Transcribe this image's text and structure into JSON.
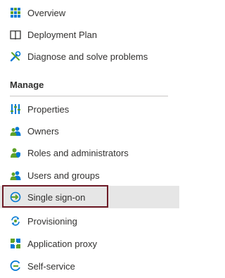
{
  "nav": {
    "top_items": [
      {
        "label": "Overview",
        "icon": "grid-icon"
      },
      {
        "label": "Deployment Plan",
        "icon": "book-icon"
      },
      {
        "label": "Diagnose and solve problems",
        "icon": "wrench-icon"
      }
    ],
    "section_title": "Manage",
    "manage_items": [
      {
        "label": "Properties",
        "icon": "properties-icon"
      },
      {
        "label": "Owners",
        "icon": "owners-icon"
      },
      {
        "label": "Roles and administrators",
        "icon": "roles-icon"
      },
      {
        "label": "Users and groups",
        "icon": "users-groups-icon"
      },
      {
        "label": "Single sign-on",
        "icon": "sso-icon",
        "selected": true
      },
      {
        "label": "Provisioning",
        "icon": "provisioning-icon"
      },
      {
        "label": "Application proxy",
        "icon": "app-proxy-icon"
      },
      {
        "label": "Self-service",
        "icon": "self-service-icon"
      }
    ],
    "colors": {
      "selected_bg": "#e6e6e6",
      "highlight_border": "#6d1a26",
      "accent_blue": "#0078d4",
      "accent_green": "#5ea229"
    }
  }
}
